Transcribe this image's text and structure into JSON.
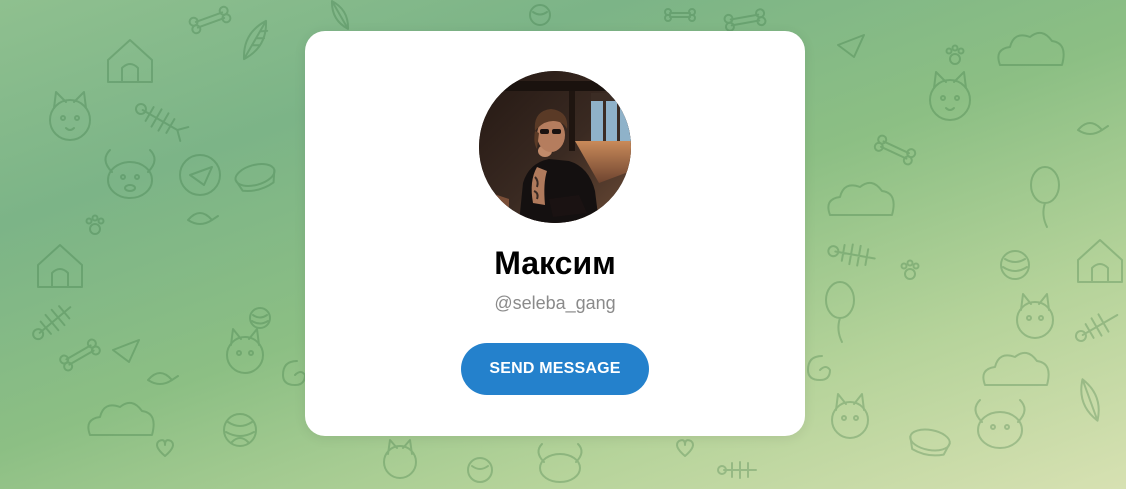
{
  "background": {
    "gradient_colors": [
      "#8fc08f",
      "#7cb487",
      "#8cbf84",
      "#b5d39a",
      "#d7e1b2"
    ],
    "pattern_icons": [
      "cat-icon",
      "dog-icon",
      "bone-icon",
      "fish-icon",
      "paper-plane-icon",
      "doghouse-icon",
      "yarn-ball-icon",
      "paw-icon",
      "bird-icon",
      "balloon-icon"
    ]
  },
  "profile": {
    "avatar_icon": "profile-photo",
    "name": "Максим",
    "username": "@seleba_gang"
  },
  "actions": {
    "send_label": "SEND MESSAGE",
    "button_color": "#2481cc"
  }
}
